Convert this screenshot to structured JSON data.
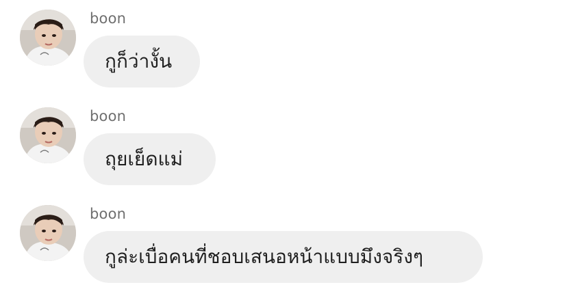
{
  "chat": {
    "messages": [
      {
        "sender": "boon",
        "text": "กูก็ว่างั้น",
        "avatar_icon": "profile-photo"
      },
      {
        "sender": "boon",
        "text": "ถุยเย็ดแม่",
        "avatar_icon": "profile-photo"
      },
      {
        "sender": "boon",
        "text": "กูล่ะเบื่อคนที่ชอบเสนอหน้าแบบมึงจริงๆ",
        "avatar_icon": "profile-photo"
      }
    ]
  },
  "colors": {
    "background": "#ffffff",
    "bubble": "#efefef",
    "sender_text": "#6f6f6f",
    "message_text": "#1f1f1f"
  }
}
